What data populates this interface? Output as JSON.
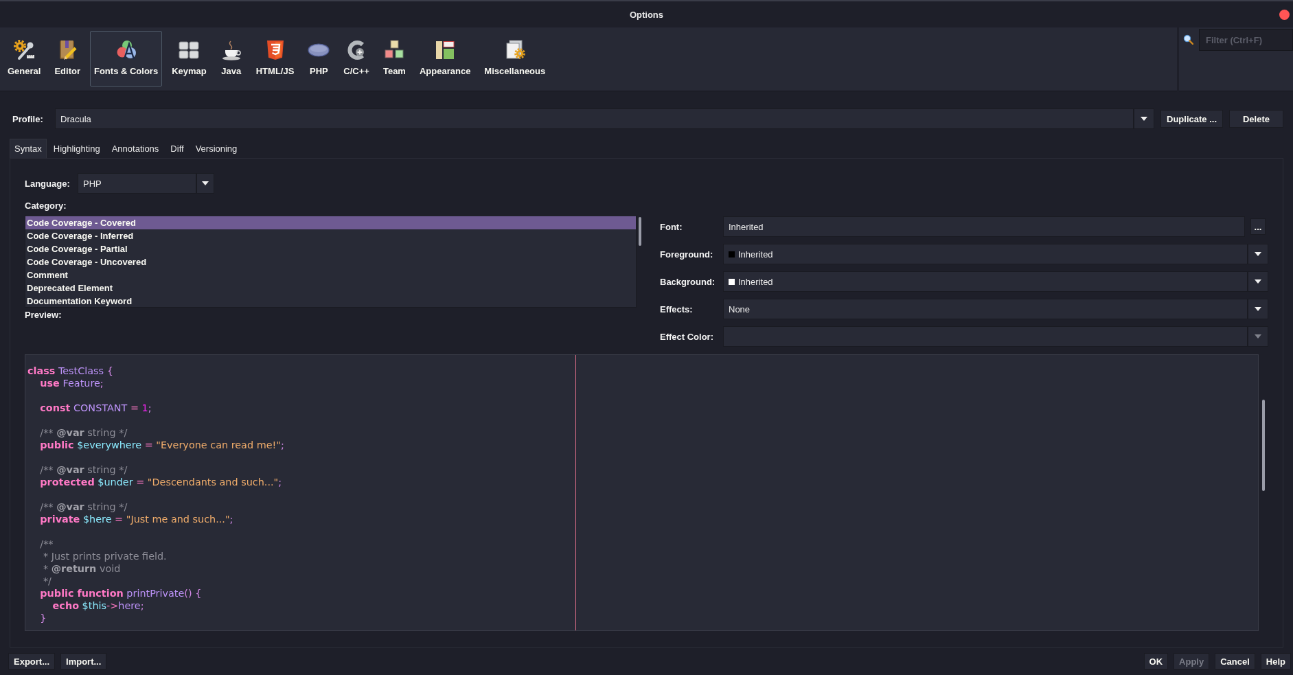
{
  "window": {
    "title": "Options"
  },
  "toolbar": {
    "items": [
      {
        "label": "General",
        "selected": false
      },
      {
        "label": "Editor",
        "selected": false
      },
      {
        "label": "Fonts & Colors",
        "selected": true
      },
      {
        "label": "Keymap",
        "selected": false
      },
      {
        "label": "Java",
        "selected": false
      },
      {
        "label": "HTML/JS",
        "selected": false
      },
      {
        "label": "PHP",
        "selected": false
      },
      {
        "label": "C/C++",
        "selected": false
      },
      {
        "label": "Team",
        "selected": false
      },
      {
        "label": "Appearance",
        "selected": false
      },
      {
        "label": "Miscellaneous",
        "selected": false
      }
    ]
  },
  "filter": {
    "placeholder": "Filter (Ctrl+F)"
  },
  "profile": {
    "label": "Profile:",
    "value": "Dracula",
    "buttons": [
      "Duplicate ...",
      "Delete"
    ]
  },
  "tabs": [
    {
      "label": "Syntax",
      "selected": true
    },
    {
      "label": "Highlighting",
      "selected": false
    },
    {
      "label": "Annotations",
      "selected": false
    },
    {
      "label": "Diff",
      "selected": false
    },
    {
      "label": "Versioning",
      "selected": false
    }
  ],
  "language": {
    "label": "Language:",
    "value": "PHP"
  },
  "category": {
    "label": "Category:",
    "items": [
      {
        "label": "Code Coverage - Covered",
        "selected": true
      },
      {
        "label": "Code Coverage - Inferred",
        "selected": false
      },
      {
        "label": "Code Coverage - Partial",
        "selected": false
      },
      {
        "label": "Code Coverage - Uncovered",
        "selected": false
      },
      {
        "label": "Comment",
        "selected": false
      },
      {
        "label": "Deprecated Element",
        "selected": false
      },
      {
        "label": "Documentation Keyword",
        "selected": false
      }
    ]
  },
  "properties": [
    {
      "label": "Font:",
      "kind": "browse",
      "value": "Inherited",
      "button": "...",
      "disabled": false
    },
    {
      "label": "Foreground:",
      "kind": "color",
      "value": "Inherited",
      "color": "#000000",
      "disabled": false
    },
    {
      "label": "Background:",
      "kind": "color",
      "value": "Inherited",
      "color": "#ffffff",
      "disabled": false
    },
    {
      "label": "Effects:",
      "kind": "combo",
      "value": "None",
      "disabled": false
    },
    {
      "label": "Effect Color:",
      "kind": "combo",
      "disabled": true
    }
  ],
  "preview": {
    "label": "Preview:",
    "blocks": [
      [
        [
          {
            "text": "class",
            "kind": "keyword"
          },
          {
            "text": " TestClass",
            "kind": "identifier"
          },
          {
            "text": " {",
            "kind": "punctuation"
          }
        ],
        [
          {
            "text": "    use",
            "kind": "keyword"
          },
          {
            "text": " Feature",
            "kind": "identifier"
          },
          {
            "text": ";",
            "kind": "punctuation"
          }
        ]
      ],
      [
        [
          {
            "text": "    const",
            "kind": "keyword"
          },
          {
            "text": " CONSTANT",
            "kind": "identifier"
          },
          {
            "text": " =",
            "kind": "operator"
          },
          {
            "text": " 1",
            "kind": "number"
          },
          {
            "text": ";",
            "kind": "punctuation"
          }
        ]
      ],
      [
        [
          {
            "text": "    /** ",
            "kind": "comment"
          },
          {
            "text": "@var",
            "kind": "doctag"
          },
          {
            "text": " string */",
            "kind": "comment"
          }
        ],
        [
          {
            "text": "    public",
            "kind": "keyword"
          },
          {
            "text": " $everywhere",
            "kind": "variable"
          },
          {
            "text": " =",
            "kind": "operator"
          },
          {
            "text": " \"Everyone can read me!\"",
            "kind": "string"
          },
          {
            "text": ";",
            "kind": "punctuation"
          }
        ]
      ],
      [
        [
          {
            "text": "    /** ",
            "kind": "comment"
          },
          {
            "text": "@var",
            "kind": "doctag"
          },
          {
            "text": " string */",
            "kind": "comment"
          }
        ],
        [
          {
            "text": "    protected",
            "kind": "keyword"
          },
          {
            "text": " $under",
            "kind": "variable"
          },
          {
            "text": " =",
            "kind": "operator"
          },
          {
            "text": " \"Descendants and such...\"",
            "kind": "string"
          },
          {
            "text": ";",
            "kind": "punctuation"
          }
        ]
      ],
      [
        [
          {
            "text": "    /** ",
            "kind": "comment"
          },
          {
            "text": "@var",
            "kind": "doctag"
          },
          {
            "text": " string */",
            "kind": "comment"
          }
        ],
        [
          {
            "text": "    private",
            "kind": "keyword"
          },
          {
            "text": " $here",
            "kind": "variable"
          },
          {
            "text": " =",
            "kind": "operator"
          },
          {
            "text": " \"Just me and such...\"",
            "kind": "string"
          },
          {
            "text": ";",
            "kind": "punctuation"
          }
        ]
      ],
      [
        [
          {
            "text": "    /**",
            "kind": "comment"
          }
        ],
        [
          {
            "text": "     * Just prints private field.",
            "kind": "comment"
          }
        ],
        [
          {
            "text": "     * ",
            "kind": "comment"
          },
          {
            "text": "@return",
            "kind": "doctag"
          },
          {
            "text": " void",
            "kind": "comment"
          }
        ],
        [
          {
            "text": "     */",
            "kind": "comment"
          }
        ],
        [
          {
            "text": "    public function",
            "kind": "keyword"
          },
          {
            "text": " printPrivate",
            "kind": "identifier"
          },
          {
            "text": "() {",
            "kind": "punctuation"
          }
        ],
        [
          {
            "text": "        echo",
            "kind": "keyword"
          },
          {
            "text": " $this",
            "kind": "variable"
          },
          {
            "text": "->",
            "kind": "operator"
          },
          {
            "text": "here",
            "kind": "identifier"
          },
          {
            "text": ";",
            "kind": "punctuation"
          }
        ],
        [
          {
            "text": "    }",
            "kind": "punctuation"
          }
        ]
      ]
    ]
  },
  "footer": {
    "left": [
      {
        "label": "Export...",
        "disabled": false
      },
      {
        "label": "Import...",
        "disabled": false
      }
    ],
    "right": [
      {
        "label": "OK",
        "disabled": false
      },
      {
        "label": "Apply",
        "disabled": true
      },
      {
        "label": "Cancel",
        "disabled": false
      },
      {
        "label": "Help",
        "disabled": false
      }
    ]
  }
}
